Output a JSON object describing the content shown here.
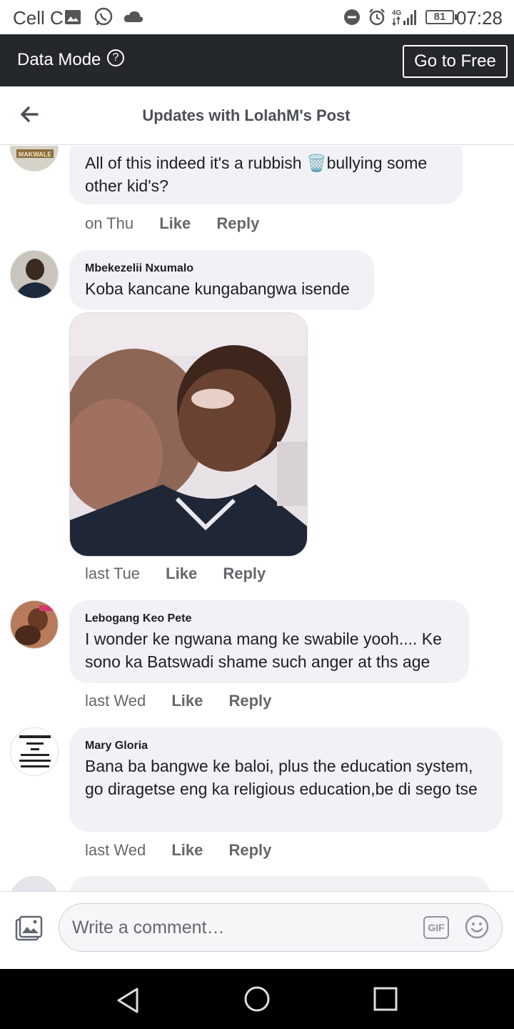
{
  "status_bar": {
    "carrier": "Cell C",
    "battery": "81",
    "time": "07:28",
    "network": "4G"
  },
  "data_mode": {
    "label": "Data Mode",
    "help_icon": "?",
    "button": "Go to Free"
  },
  "header": {
    "title": "Updates with LolahM's Post"
  },
  "comments": [
    {
      "name": "",
      "text": "All of this indeed it's a rubbish 🗑️bullying some other kid's?",
      "time": "on Thu",
      "like": "Like",
      "reply": "Reply"
    },
    {
      "name": "Mbekezelii Nxumalo",
      "text": "Koba kancane kungabangwa isende",
      "time": "last Tue",
      "like": "Like",
      "reply": "Reply"
    },
    {
      "name": "Lebogang Keo Pete",
      "text": "I wonder ke ngwana mang ke swabile yooh.... Ke sono ka Batswadi shame such anger at ths age",
      "time": "last Wed",
      "like": "Like",
      "reply": "Reply"
    },
    {
      "name": "Mary Gloria",
      "text": "Bana ba bangwe ke baloi, plus the education system, go diragetse eng ka religious education,be di sego tse",
      "time": "last Wed",
      "like": "Like",
      "reply": "Reply"
    }
  ],
  "avatar_badge": "MAKWALE",
  "compose": {
    "placeholder": "Write a comment…",
    "gif_label": "GIF"
  },
  "colors": {
    "data_mode_bg": "#24272c",
    "bubble_bg": "#f0f2f5",
    "nav_bg": "#000000"
  }
}
